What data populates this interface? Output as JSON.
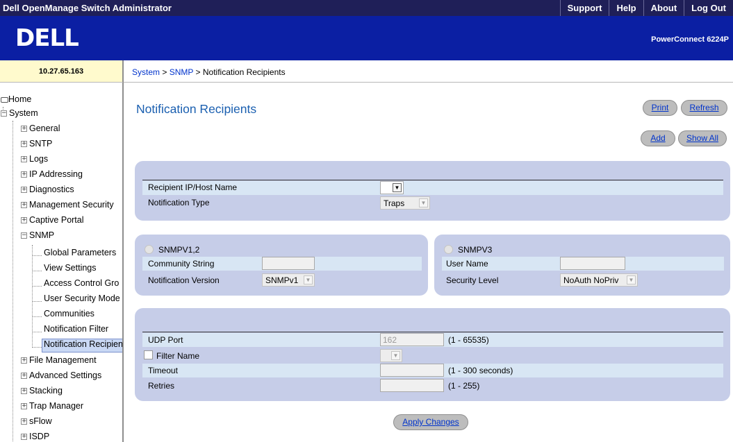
{
  "topbar": {
    "title": "Dell OpenManage Switch Administrator",
    "links": [
      "Support",
      "Help",
      "About",
      "Log Out"
    ]
  },
  "banner": {
    "logo": "DELL",
    "model": "PowerConnect 6224P"
  },
  "ip": "10.27.65.163",
  "breadcrumb": {
    "system": "System",
    "snmp": "SNMP",
    "current": "Notification Recipients",
    "sep": ">"
  },
  "sidebar": {
    "home": "Home",
    "system": "System",
    "general": "General",
    "sntp": "SNTP",
    "logs": "Logs",
    "ip_addressing": "IP Addressing",
    "diagnostics": "Diagnostics",
    "management_security": "Management Security",
    "captive_portal": "Captive Portal",
    "snmp": "SNMP",
    "snmp_children": [
      "Global Parameters",
      "View Settings",
      "Access Control Gro",
      "User Security Mode",
      "Communities",
      "Notification Filter",
      "Notification Recipien"
    ],
    "file_management": "File Management",
    "advanced_settings": "Advanced Settings",
    "stacking": "Stacking",
    "trap_manager": "Trap Manager",
    "sflow": "sFlow",
    "isdp": "ISDP"
  },
  "page": {
    "title": "Notification Recipients",
    "print": "Print",
    "refresh": "Refresh",
    "add": "Add",
    "show_all": "Show All",
    "apply": "Apply Changes"
  },
  "recipient": {
    "ip_label": "Recipient IP/Host Name",
    "ip_value": "",
    "type_label": "Notification Type",
    "type_value": "Traps"
  },
  "snmpv12": {
    "title": "SNMPV1,2",
    "community_label": "Community String",
    "community_value": "",
    "version_label": "Notification Version",
    "version_value": "SNMPv1"
  },
  "snmpv3": {
    "title": "SNMPV3",
    "user_label": "User Name",
    "user_value": "",
    "security_label": "Security Level",
    "security_value": "NoAuth NoPriv"
  },
  "options": {
    "udp_label": "UDP Port",
    "udp_placeholder": "162",
    "udp_hint": "(1 - 65535)",
    "filter_label": "Filter Name",
    "timeout_label": "Timeout",
    "timeout_hint": "(1 - 300 seconds)",
    "retries_label": "Retries",
    "retries_hint": "(1 - 255)"
  }
}
